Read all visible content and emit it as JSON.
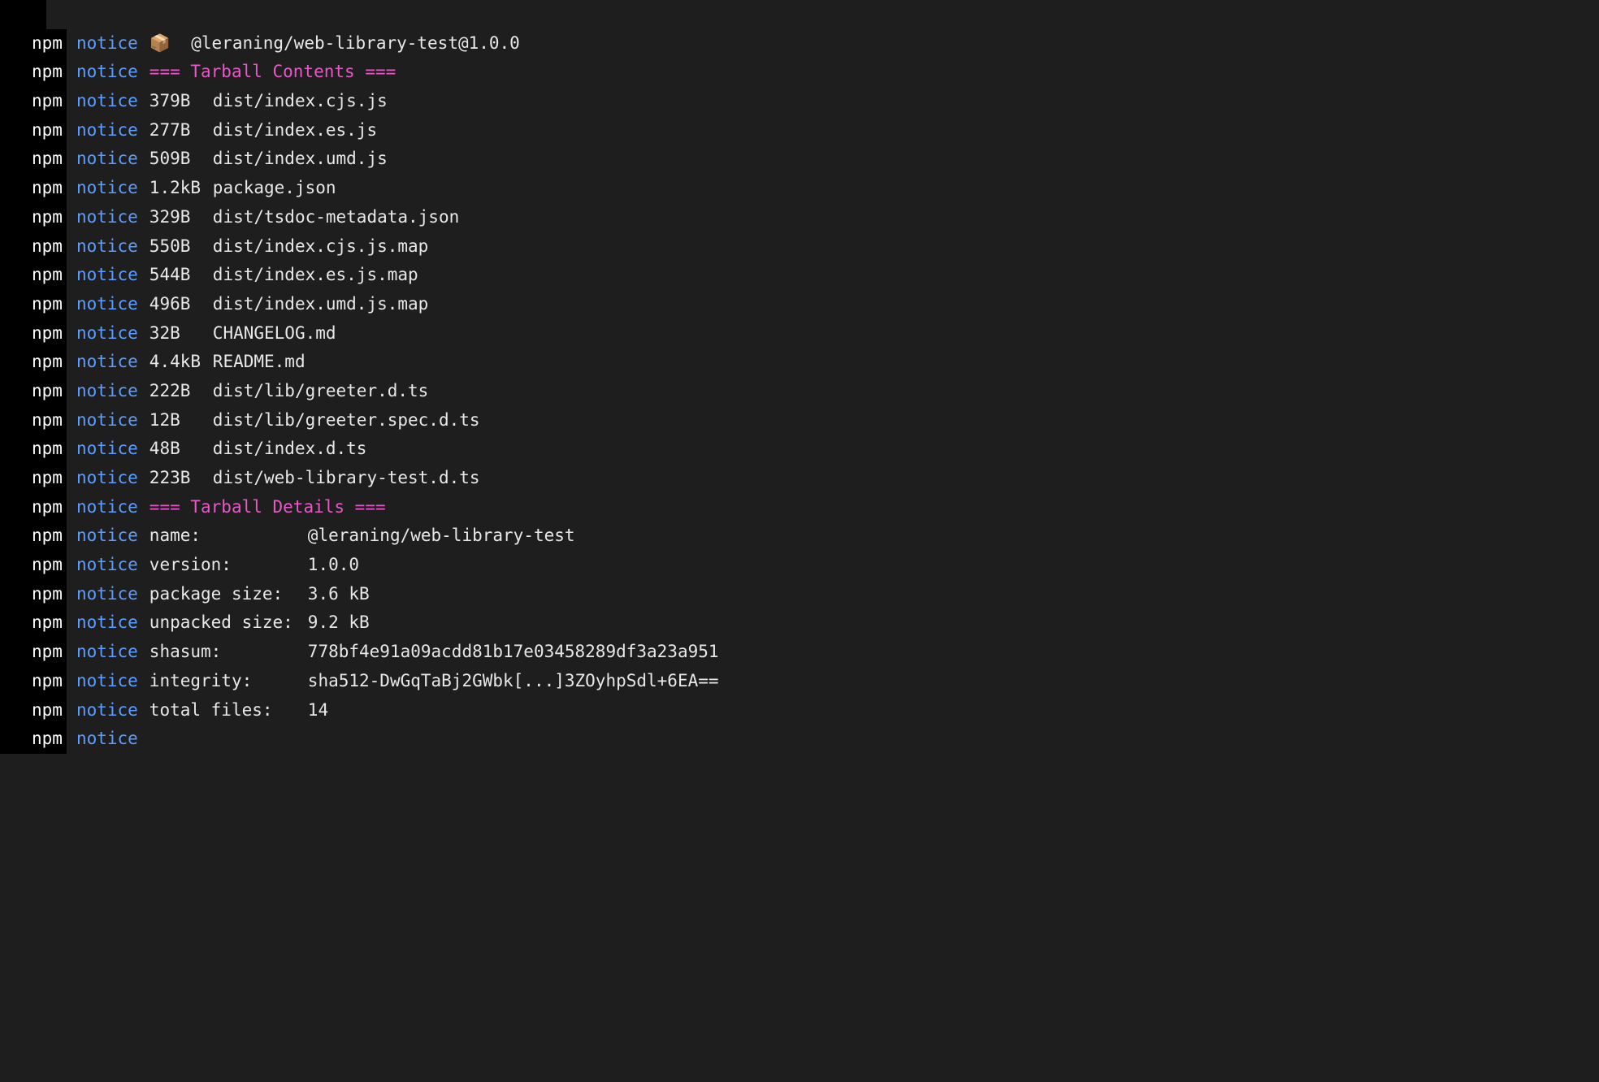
{
  "prefix": {
    "npm": "npm",
    "notice": "notice"
  },
  "header": {
    "icon": "📦",
    "pkg": "@leraning/web-library-test@1.0.0"
  },
  "tarball_contents_header": {
    "eq1": "=== ",
    "label": "Tarball Contents",
    "eq2": " ==="
  },
  "files": [
    {
      "size": "379B",
      "path": "dist/index.cjs.js"
    },
    {
      "size": "277B",
      "path": "dist/index.es.js"
    },
    {
      "size": "509B",
      "path": "dist/index.umd.js"
    },
    {
      "size": "1.2kB",
      "path": "package.json"
    },
    {
      "size": "329B",
      "path": "dist/tsdoc-metadata.json"
    },
    {
      "size": "550B",
      "path": "dist/index.cjs.js.map"
    },
    {
      "size": "544B",
      "path": "dist/index.es.js.map"
    },
    {
      "size": "496B",
      "path": "dist/index.umd.js.map"
    },
    {
      "size": "32B",
      "path": "CHANGELOG.md"
    },
    {
      "size": "4.4kB",
      "path": "README.md"
    },
    {
      "size": "222B",
      "path": "dist/lib/greeter.d.ts"
    },
    {
      "size": "12B",
      "path": "dist/lib/greeter.spec.d.ts"
    },
    {
      "size": "48B",
      "path": "dist/index.d.ts"
    },
    {
      "size": "223B",
      "path": "dist/web-library-test.d.ts"
    }
  ],
  "tarball_details_header": {
    "eq1": "=== ",
    "label": "Tarball Details",
    "eq2": " ==="
  },
  "details": [
    {
      "label": "name:",
      "value": "@leraning/web-library-test"
    },
    {
      "label": "version:",
      "value": "1.0.0"
    },
    {
      "label": "package size:",
      "value": "3.6 kB"
    },
    {
      "label": "unpacked size:",
      "value": "9.2 kB"
    },
    {
      "label": "shasum:",
      "value": "778bf4e91a09acdd81b17e03458289df3a23a951"
    },
    {
      "label": "integrity:",
      "value": "sha512-DwGqTaBj2GWbk[...]3ZOyhpSdl+6EA=="
    },
    {
      "label": "total files:",
      "value": "14"
    }
  ]
}
